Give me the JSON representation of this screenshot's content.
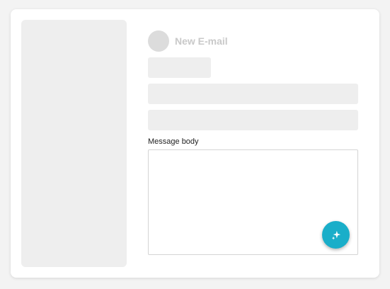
{
  "compose": {
    "title": "New E-mail",
    "message_label": "Message body",
    "message_value": "",
    "fab_icon": "sparkle-icon"
  },
  "colors": {
    "accent": "#1aaec9",
    "placeholder": "#eeeeee"
  }
}
